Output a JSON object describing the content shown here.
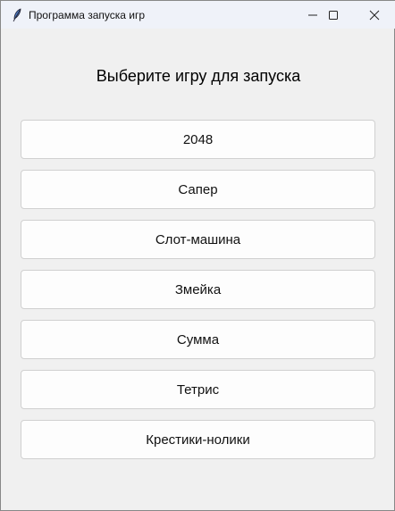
{
  "window": {
    "title": "Программа запуска игр"
  },
  "heading": "Выберите игру для запуска",
  "games": [
    "2048",
    "Сапер",
    "Слот-машина",
    "Змейка",
    "Сумма",
    "Тетрис",
    "Крестики-нолики"
  ]
}
